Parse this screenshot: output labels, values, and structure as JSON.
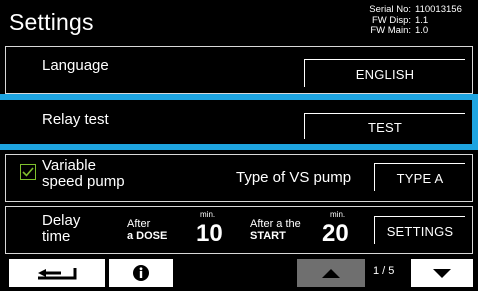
{
  "header": {
    "title": "Settings",
    "serial_label": "Serial No:",
    "serial_value": "110013156",
    "fw_disp_label": "FW Disp:",
    "fw_disp_value": "1.1",
    "fw_main_label": "FW Main:",
    "fw_main_value": "1.0"
  },
  "language": {
    "label": "Language",
    "value": "ENGLISH"
  },
  "relay": {
    "label": "Relay test",
    "button": "TEST",
    "highlight_color": "#1ea4e0"
  },
  "pump": {
    "checkbox_checked": true,
    "variable_line1": "Variable",
    "variable_line2": "speed pump",
    "type_label": "Type of VS pump",
    "type_value": "TYPE A",
    "checkbox_color": "#7fbf2d"
  },
  "delay": {
    "label_line1": "Delay",
    "label_line2": "time",
    "after_dose_line1": "After",
    "after_dose_line2": "a DOSE",
    "dose_value": "10",
    "dose_unit": "min.",
    "after_start_line1": "After a the",
    "after_start_line2": "START",
    "start_value": "20",
    "start_unit": "min.",
    "settings_button": "SETTINGS"
  },
  "nav": {
    "back_icon": "return-arrow-icon",
    "info_icon": "info-icon",
    "up_icon": "triangle-up-icon",
    "down_icon": "triangle-down-icon",
    "page_indicator": "1 / 5"
  }
}
